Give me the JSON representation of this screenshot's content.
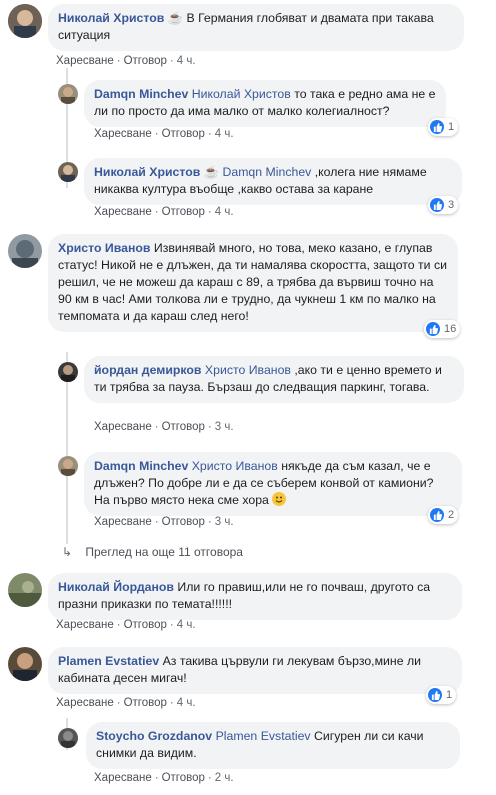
{
  "labels": {
    "like": "Харесване",
    "reply": "Отговор"
  },
  "comments": [
    {
      "author": "Николай Христов",
      "badge": "☕",
      "tag": "",
      "text": "В Германия глобяват и двамата при такава ситуация",
      "time": "4 ч."
    },
    {
      "author": "Damqn Minchev",
      "tag": "Николай Христов",
      "text": "то така е редно ама не е ли по просто да има малко от малко колегиалност?",
      "time": "4 ч.",
      "likes": "1"
    },
    {
      "author": "Николай Христов",
      "badge": "☕",
      "tag": "Damqn Minchev",
      "text": ",колега ние нямаме никаква култура въобще ,какво остава за каране",
      "time": "4 ч.",
      "likes": "3"
    },
    {
      "author": "Христо Иванов",
      "tag": "",
      "text": "Извинявай много, но това, меко казано, е глупав статус! Никой не е длъжен, да ти намалява скоростта, защото ти си решил, че не можеш да караш с 89, а трябва да вървиш точно на 90 км в час! Ами толкова ли е трудно, да чукнеш 1 км по малко на темпомата и да караш след него!",
      "time": "",
      "likes": "16"
    },
    {
      "author": "йордан демирков",
      "tag": "Христо Иванов",
      "text": ",ако ти е ценно времето и ти трябва за пауза. Бързаш до следващия паркинг, тогава.",
      "time": "3 ч."
    },
    {
      "author": "Damqn Minchev",
      "tag": "Христо Иванов",
      "text": "някъде да съм казал, че е длъжен? По добре ли е да се съберем конвой от камиони? На първо място нека сме хора",
      "time": "3 ч.",
      "likes": "2"
    },
    {
      "author": "Николай Йорданов",
      "tag": "",
      "text": "Или го правиш,или не го почваш, другото са празни приказки по темата!!!!!!",
      "time": "4 ч."
    },
    {
      "author": "Plamen Evstatiev",
      "tag": "",
      "text": "Аз такива цървули ги лекувам бързо,мине ли кабината десен мигач!",
      "time": "4 ч.",
      "likes": "1"
    },
    {
      "author": "Stoycho Grozdanov",
      "tag": "Plamen Evstatiev",
      "text": "Сигурен ли си качи снимки да видим.",
      "time": "2 ч."
    }
  ],
  "more_replies": "Преглед на още 11 отговора",
  "colors": {
    "link": "#385898",
    "bubble": "#f2f3f5",
    "like_blue": "#2078f4"
  }
}
